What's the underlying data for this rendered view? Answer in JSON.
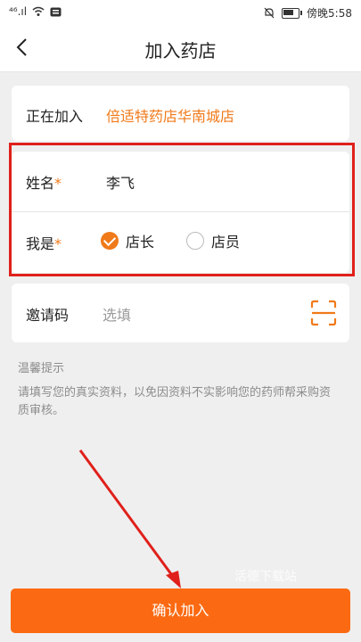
{
  "status_bar": {
    "signal": "⁴⁶.ıl",
    "time": "傍晚5:58"
  },
  "header": {
    "title": "加入药店"
  },
  "joining": {
    "label": "正在加入",
    "store_name": "倍适特药店华南城店"
  },
  "form": {
    "name_label": "姓名",
    "name_value": "李飞",
    "role_label": "我是",
    "required_mark": "*",
    "role_options": [
      {
        "label": "店长",
        "checked": true
      },
      {
        "label": "店员",
        "checked": false
      }
    ],
    "invite_label": "邀请码",
    "invite_placeholder": "选填"
  },
  "tips": {
    "title": "温馨提示",
    "body": "请填写您的真实资料，以免因资料不实影响您的药师帮采购资质审核。"
  },
  "watermark": "活德下载站",
  "confirm_label": "确认加入",
  "colors": {
    "accent": "#f07a1a",
    "button": "#fb6a12",
    "annotation": "#e0201b"
  }
}
